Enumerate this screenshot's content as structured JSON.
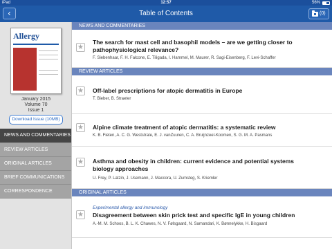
{
  "status_bar": {
    "carrier": "iPad",
    "time": "12:57",
    "battery": "56%"
  },
  "nav": {
    "back_glyph": "‹",
    "title": "Table of Contents",
    "downloads_count": "(0)"
  },
  "issue": {
    "cover_logo": "Allergy",
    "date": "January 2015",
    "volume": "Volume 70",
    "issue": "Issue 1",
    "download_label": "Download Issue (10MB)"
  },
  "sidebar": {
    "items": [
      {
        "label": "NEWS AND COMMENTARIES"
      },
      {
        "label": "REVIEW ARTICLES"
      },
      {
        "label": "ORIGINAL ARTICLES"
      },
      {
        "label": "BRIEF COMMUNICATIONS"
      },
      {
        "label": "CORRESPONDENCE"
      }
    ]
  },
  "sections": [
    {
      "header": "NEWS AND COMMENTARIES",
      "articles": [
        {
          "title": "The search for mast cell and basophil models – are we getting closer to pathophysiological relevance?",
          "authors": "F. Siebenhaar, F. H. Falcone, E. Tiligada, I. Hammel, M. Maurer, R. Sagi-Eisenberg, F. Levi-Schaffer"
        }
      ]
    },
    {
      "header": "REVIEW ARTICLES",
      "articles": [
        {
          "title": "Off-label prescriptions for atopic dermatitis in Europe",
          "authors": "T. Bieber, B. Straeter"
        },
        {
          "title": "Alpine climate treatment of atopic dermatitis: a systematic review",
          "authors": "K. B. Fieten, A. C. G. Weststrate, E. J. vanZuuren, C. A. Bruijnzeel-Koomen, S. G. M. A. Pasmans"
        },
        {
          "title": "Asthma and obesity in children: current evidence and potential systems biology approaches",
          "authors": "U. Frey, P. Latzin, J. Usemann, J. Maccora, U. Zumsteg, S. Kriemler"
        }
      ]
    },
    {
      "header": "ORIGINAL ARTICLES",
      "articles": [
        {
          "category": "Experimental allergy and immunology",
          "title": "Disagreement between skin prick test and specific IgE in young children",
          "authors": "A.-M. M. Schoos, B. L. K. Chawes, N. V. Følsgaard, N. Samandari, K. Bønnelykke, H. Bisgaard"
        }
      ]
    }
  ],
  "star_glyph": "★"
}
